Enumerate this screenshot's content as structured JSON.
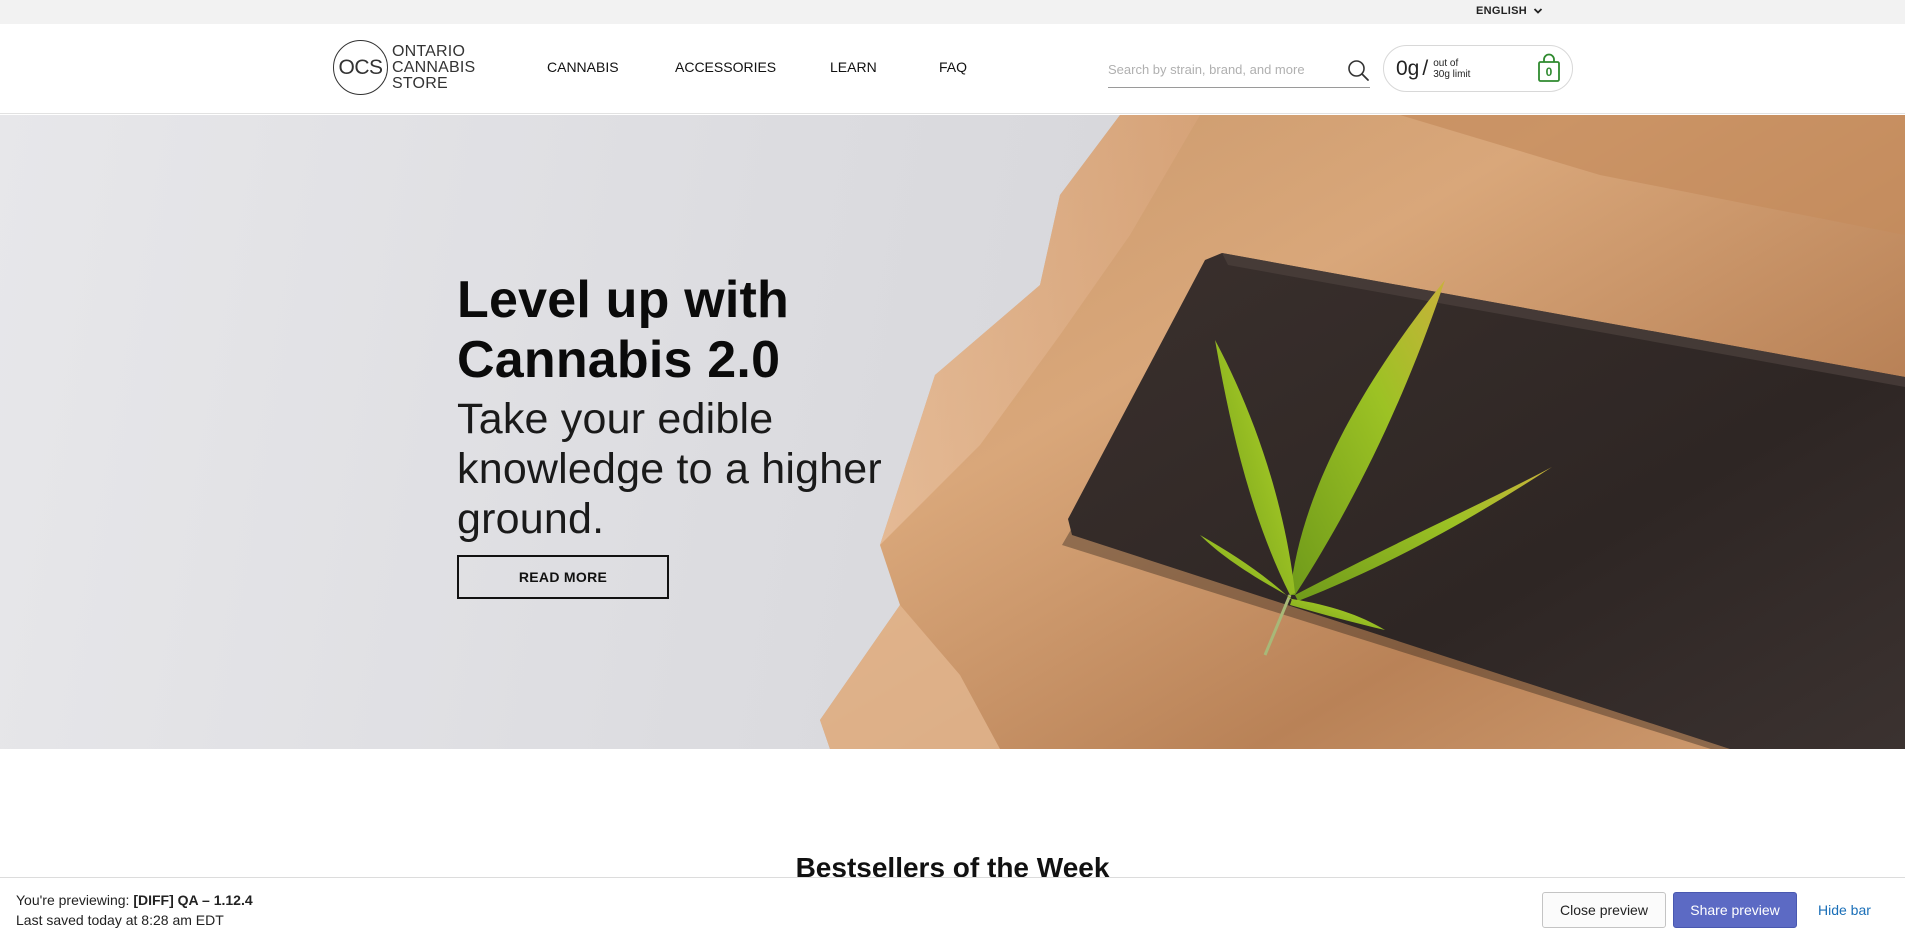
{
  "topbar": {
    "language": "ENGLISH"
  },
  "header": {
    "logo": {
      "mark": "OCS",
      "line1": "ONTARIO",
      "line2": "CANNABIS",
      "line3": "STORE"
    },
    "nav": [
      "CANNABIS",
      "ACCESSORIES",
      "LEARN",
      "FAQ"
    ],
    "search": {
      "placeholder": "Search by strain, brand, and more",
      "value": ""
    },
    "limit": {
      "amount": "0g",
      "line1": "out of",
      "line2": "30g limit"
    },
    "cart": {
      "count": "0"
    }
  },
  "hero": {
    "title_line1": "Level up with",
    "title_line2": "Cannabis 2.0",
    "subtitle_line1": "Take your edible",
    "subtitle_line2": "knowledge to a higher",
    "subtitle_line3": "ground.",
    "cta": "READ MORE"
  },
  "section": {
    "title": "Bestsellers of the Week"
  },
  "preview_bar": {
    "previewing_prefix": "You're previewing:",
    "theme_name": "[DIFF] QA – 1.12.4",
    "saved_text": "Last saved today at 8:28 am EDT",
    "close_label": "Close preview",
    "share_label": "Share preview",
    "hide_label": "Hide bar"
  },
  "colors": {
    "accent_share": "#5c6ac4",
    "cart_green": "#2f8a2f",
    "link_blue": "#1a6fb8"
  },
  "icons": [
    "chevron-down-icon",
    "search-icon",
    "shopping-bag-icon",
    "cannabis-leaf-illustration"
  ]
}
